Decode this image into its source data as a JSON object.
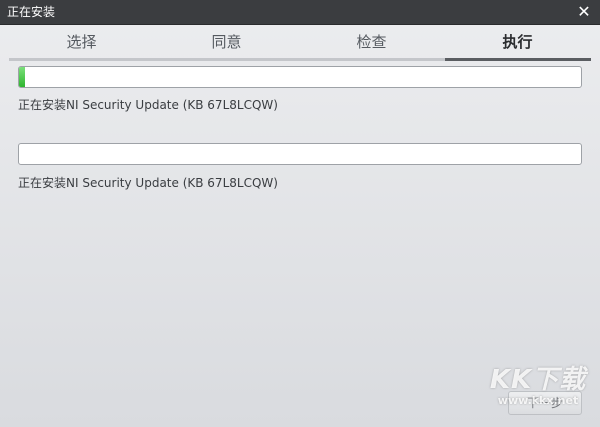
{
  "window": {
    "title": "正在安装"
  },
  "tabs": [
    "选择",
    "同意",
    "检查",
    "执行"
  ],
  "active_tab": 3,
  "install_items": [
    {
      "progress": 0.01,
      "status": "正在安装NI Security Update (KB 67L8LCQW)"
    },
    {
      "progress": 0.0,
      "status": "正在安装NI Security Update (KB 67L8LCQW)"
    }
  ],
  "footer": {
    "next_label": "下一步"
  },
  "watermark": {
    "text": "KK下载",
    "url": "www.kkx.net"
  },
  "icons": {
    "close": "close-icon"
  },
  "colors": {
    "progress_fill": "#2fb52f",
    "titlebar": "#3b3d40"
  }
}
